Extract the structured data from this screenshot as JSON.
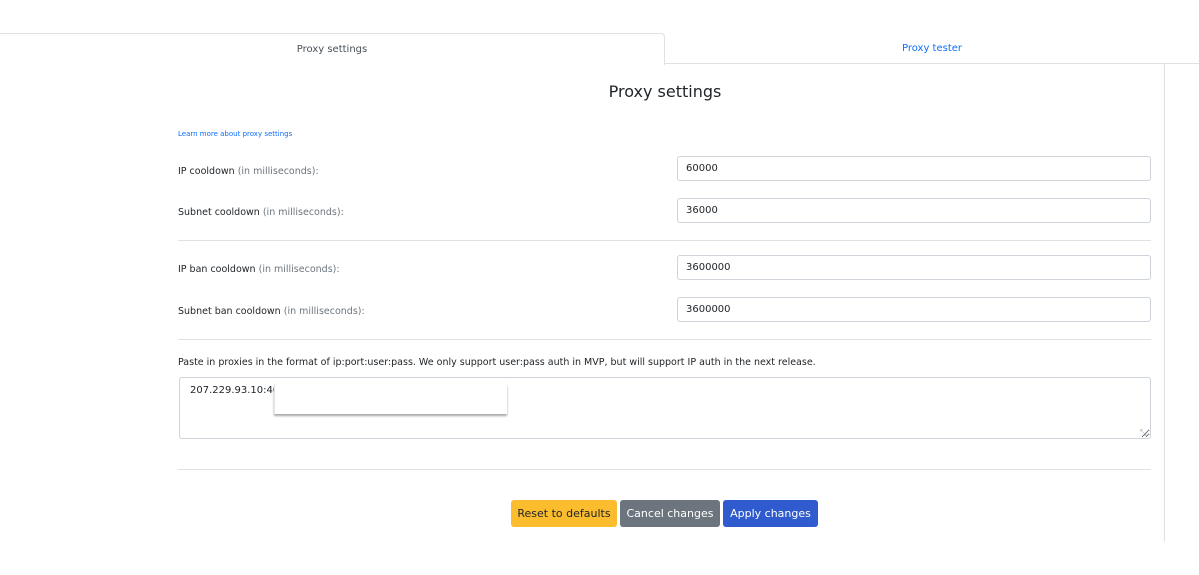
{
  "tabs": [
    {
      "label": "Proxy settings",
      "active": true
    },
    {
      "label": "Proxy tester",
      "active": false
    }
  ],
  "page": {
    "title": "Proxy settings",
    "learn_more": "Learn more about proxy settings"
  },
  "fields": {
    "ip_cooldown": {
      "label": "IP cooldown",
      "hint": "(in milliseconds):",
      "value": "60000"
    },
    "subnet_cooldown": {
      "label": "Subnet cooldown",
      "hint": "(in milliseconds):",
      "value": "36000"
    },
    "ip_ban_cooldown": {
      "label": "IP ban cooldown",
      "hint": "(in milliseconds):",
      "value": "3600000"
    },
    "subnet_ban_cooldown": {
      "label": "Subnet ban cooldown",
      "hint": "(in milliseconds):",
      "value": "3600000"
    }
  },
  "proxies": {
    "note": "Paste in proxies in the format of ip:port:user:pass. We only support user:pass auth in MVP, but will support IP auth in the next release.",
    "value": "207.229.93.10:400"
  },
  "buttons": {
    "reset": "Reset to defaults",
    "cancel": "Cancel changes",
    "apply": "Apply changes"
  },
  "colors": {
    "link": "#0d6efd",
    "reset_button": "#fbbd2e",
    "cancel_button": "#6c757d",
    "apply_button": "#2f5bce"
  }
}
